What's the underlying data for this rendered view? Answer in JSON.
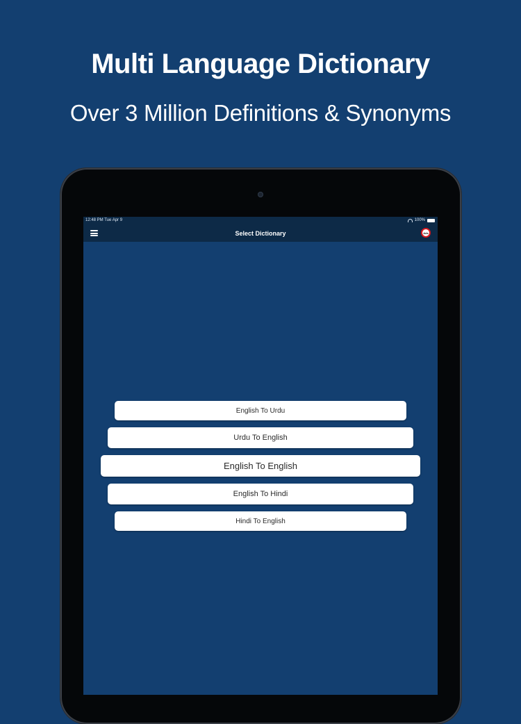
{
  "promo": {
    "headline": "Multi Language Dictionary",
    "subheadline": "Over  3 Million Definitions & Synonyms"
  },
  "status_bar": {
    "time": "12:48 PM  Tue Apr 9",
    "battery_text": "100%"
  },
  "nav": {
    "title": "Select Dictionary",
    "ad_badge": "Ads"
  },
  "dictionaries": [
    {
      "label": "English To Urdu"
    },
    {
      "label": "Urdu To English"
    },
    {
      "label": "English To English"
    },
    {
      "label": "English To Hindi"
    },
    {
      "label": "Hindi To English"
    }
  ],
  "colors": {
    "background": "#133f70",
    "navbar": "#0d2a47",
    "button": "#ffffff",
    "ad_badge_ring": "#d7191f"
  }
}
